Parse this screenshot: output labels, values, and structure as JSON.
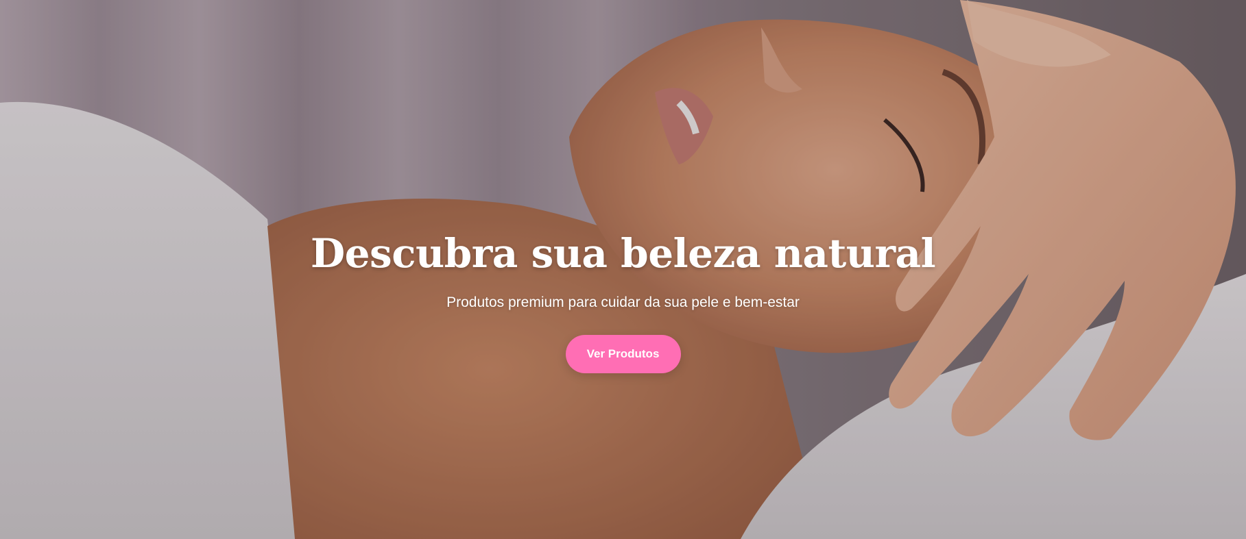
{
  "hero": {
    "title": "Descubra sua beleza natural",
    "subtitle": "Produtos premium para cuidar da sua pele e bem-estar",
    "cta_label": "Ver Produtos",
    "image_alt": "Mulher recebendo massagem facial em spa"
  },
  "colors": {
    "accent": "#ff6eb4",
    "text": "#ffffff"
  }
}
